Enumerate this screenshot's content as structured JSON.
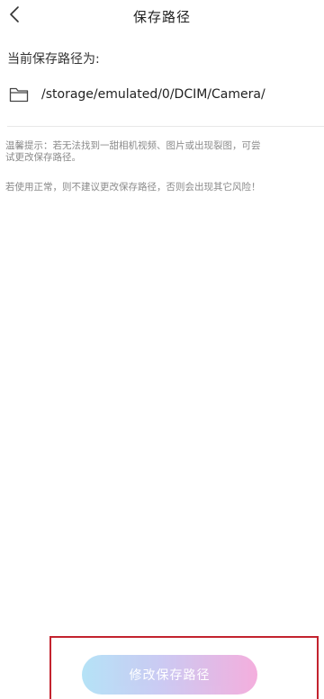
{
  "header": {
    "title": "保存路径",
    "back_icon": "chevron-left-icon"
  },
  "current_path": {
    "label": "当前保存路径为:",
    "folder_icon": "folder-icon",
    "value": "/storage/emulated/0/DCIM/Camera/"
  },
  "tips": {
    "tip1_line1": "温馨提示：若无法找到一甜相机视频、图片或出现裂图，可尝",
    "tip1_line2": "试更改保存路径。",
    "tip2": "若使用正常，则不建议更改保存路径，否则会出现其它风险！"
  },
  "actions": {
    "modify_button_label": "修改保存路径"
  },
  "colors": {
    "highlight_border": "#c3232f",
    "button_gradient_start": "#aee0f6",
    "button_gradient_end": "#f3a7da",
    "tip_text": "#8a8a8a"
  }
}
